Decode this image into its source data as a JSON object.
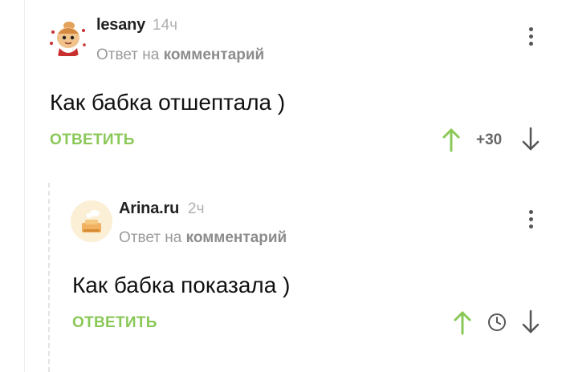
{
  "comments": [
    {
      "username": "lesany",
      "time": "14ч",
      "reply_prefix": "Ответ на",
      "reply_target": "комментарий",
      "text": "Как бабка отшептала )",
      "reply_label": "ОТВЕТИТЬ",
      "rating": "+30"
    },
    {
      "username": "Arina.ru",
      "time": "2ч",
      "reply_prefix": "Ответ на",
      "reply_target": "комментарий",
      "text": "Как бабка показала )",
      "reply_label": "ОТВЕТИТЬ"
    }
  ],
  "colors": {
    "accent_green": "#8ac858",
    "vote_arrow": "#8ac858",
    "down_arrow": "#555555"
  },
  "icons": [
    "avatar-illustration",
    "more-options-icon",
    "upvote-arrow-icon",
    "downvote-arrow-icon",
    "clock-icon"
  ]
}
